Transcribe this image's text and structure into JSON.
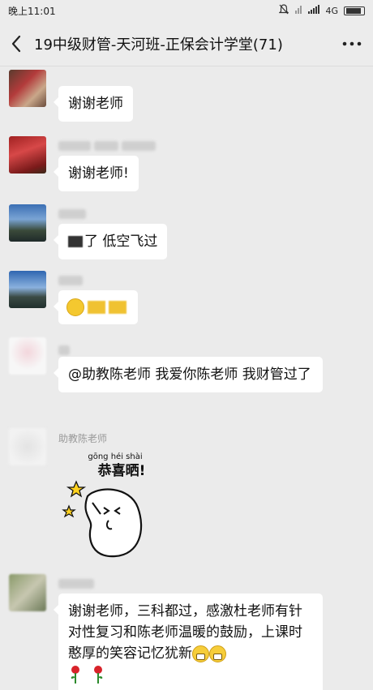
{
  "status": {
    "time": "晚上11:01",
    "network": "4G"
  },
  "header": {
    "title": "19中级财管-天河班-正保会计学堂(71)",
    "back_icon": "chevron-left-icon",
    "more_icon": "more-dots-icon"
  },
  "messages": [
    {
      "sender": "",
      "text": "谢谢老师"
    },
    {
      "sender": "",
      "text": "谢谢老师!"
    },
    {
      "sender": "",
      "text": "了 低空飞过"
    },
    {
      "sender": "",
      "text": ""
    },
    {
      "sender": "",
      "text": "@助教陈老师  我爱你陈老师 我财管过了"
    },
    {
      "sender": "助教陈老师",
      "sticker": {
        "pinyin": "gōng héi shài",
        "caption": "恭喜晒!"
      }
    },
    {
      "sender": "",
      "text": "谢谢老师，三科都过，感激杜老师有针对性复习和陈老师温暖的鼓励，上课时憨厚的笑容记忆犹新"
    }
  ],
  "colors": {
    "background": "#ebebeb",
    "bubble": "#ffffff",
    "header": "#ececec"
  }
}
